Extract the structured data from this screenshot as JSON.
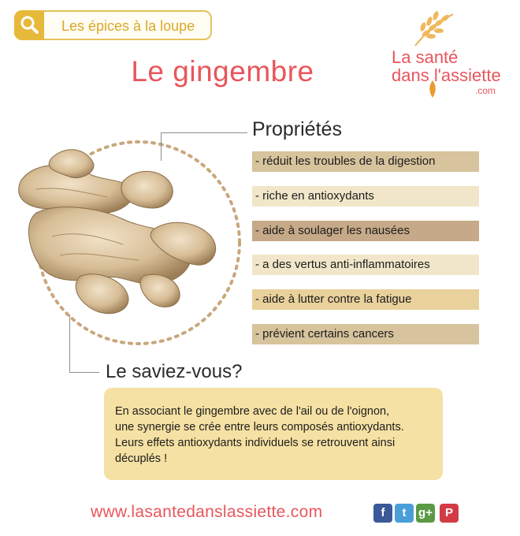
{
  "header": {
    "badge_label": "Les épices à la loupe",
    "badge_icon": "magnifier-icon",
    "title": "Le gingembre"
  },
  "logo": {
    "line1": "La santé",
    "line2": "dans l'assiette",
    "com": ".com"
  },
  "properties": {
    "heading": "Propriétés",
    "items": [
      {
        "label": "- réduit les troubles de la digestion",
        "color": "#d7c39c"
      },
      {
        "label": "- riche en antioxydants",
        "color": "#f1e6c9"
      },
      {
        "label": "- aide à soulager les nausées",
        "color": "#c6a988"
      },
      {
        "label": "- a des vertus anti-inflammatoires",
        "color": "#f1e6c9"
      },
      {
        "label": "- aide à lutter contre la fatigue",
        "color": "#e9d19b"
      },
      {
        "label": "- prévient certains cancers",
        "color": "#d7c39c"
      }
    ]
  },
  "did_you_know": {
    "heading": "Le saviez-vous?",
    "lines": [
      "En associant le gingembre avec de l'ail ou de l'oignon,",
      "une synergie se crée entre leurs composés antioxydants.",
      "Leurs effets antioxydants individuels se retrouvent ainsi",
      "décuplés !"
    ]
  },
  "footer": {
    "url": "www.lasantedanslassiette.com",
    "social": [
      {
        "name": "facebook-icon",
        "glyph": "f",
        "color": "#3b5998"
      },
      {
        "name": "twitter-icon",
        "glyph": "t",
        "color": "#4a9fd8"
      },
      {
        "name": "google-plus-icon",
        "glyph": "g+",
        "color": "#5b9a44"
      },
      {
        "name": "pinterest-icon",
        "glyph": "P",
        "color": "#d23b45"
      }
    ]
  },
  "colors": {
    "title": "#e8565c",
    "badge": "#e7b93a",
    "box": "#f5e1a3"
  }
}
